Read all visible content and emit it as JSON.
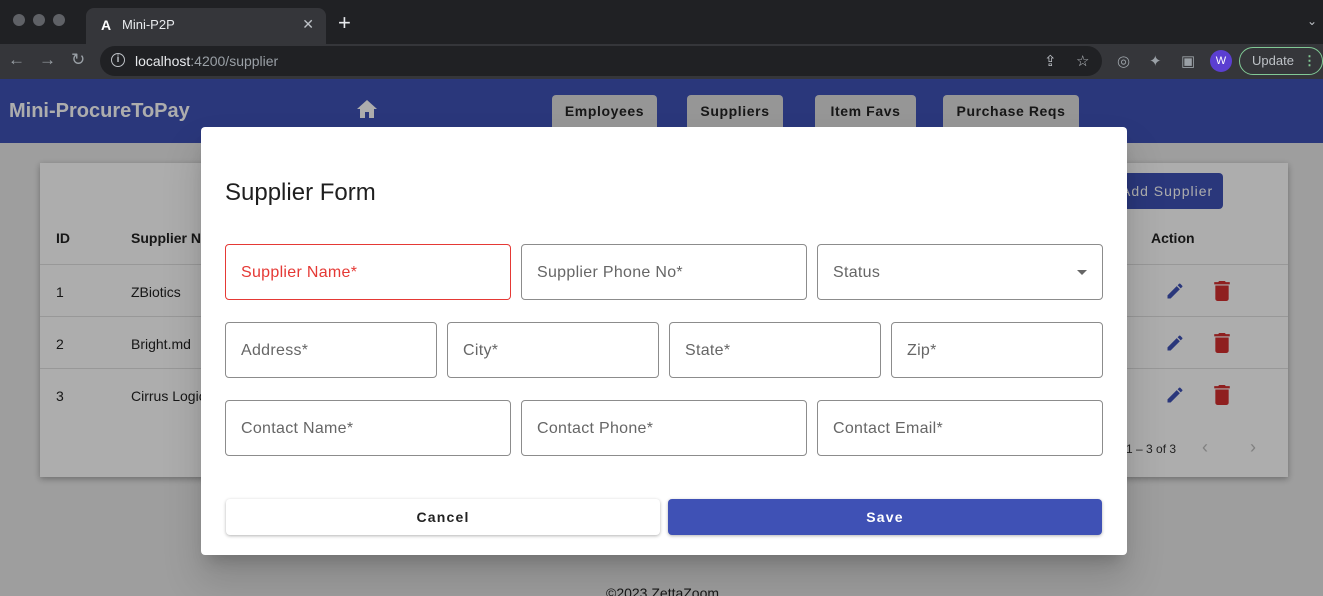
{
  "browser": {
    "tab_title": "Mini-P2P",
    "url_host": "localhost",
    "url_path": ":4200/supplier",
    "profile_initial": "W",
    "update_label": "Update"
  },
  "app": {
    "brand": "Mini-ProcureToPay",
    "nav": [
      "Employees",
      "Suppliers",
      "Item Favs",
      "Purchase Reqs"
    ],
    "add_button": "Add Supplier",
    "table": {
      "headers": [
        "ID",
        "Supplier Name",
        "Action"
      ],
      "rows": [
        {
          "id": "1",
          "name": "ZBiotics"
        },
        {
          "id": "2",
          "name": "Bright.md"
        },
        {
          "id": "3",
          "name": "Cirrus Logic"
        }
      ]
    },
    "paginator": "1 – 3 of 3",
    "footer": "©2023 ZettaZoom"
  },
  "dialog": {
    "title": "Supplier Form",
    "fields": {
      "supplier_name": "Supplier Name*",
      "supplier_phone": "Supplier Phone No*",
      "status": "Status",
      "address": "Address*",
      "city": "City*",
      "state": "State*",
      "zip": "Zip*",
      "contact_name": "Contact Name*",
      "contact_phone": "Contact Phone*",
      "contact_email": "Contact Email*"
    },
    "cancel_label": "Cancel",
    "save_label": "Save"
  },
  "colors": {
    "primary": "#3f51b5",
    "error": "#e53935",
    "delete": "#d32f2f"
  },
  "icons": [
    "home-icon",
    "edit-icon",
    "delete-icon",
    "chevron-left-icon",
    "chevron-right-icon",
    "star-icon",
    "share-icon",
    "extensions-icon"
  ]
}
